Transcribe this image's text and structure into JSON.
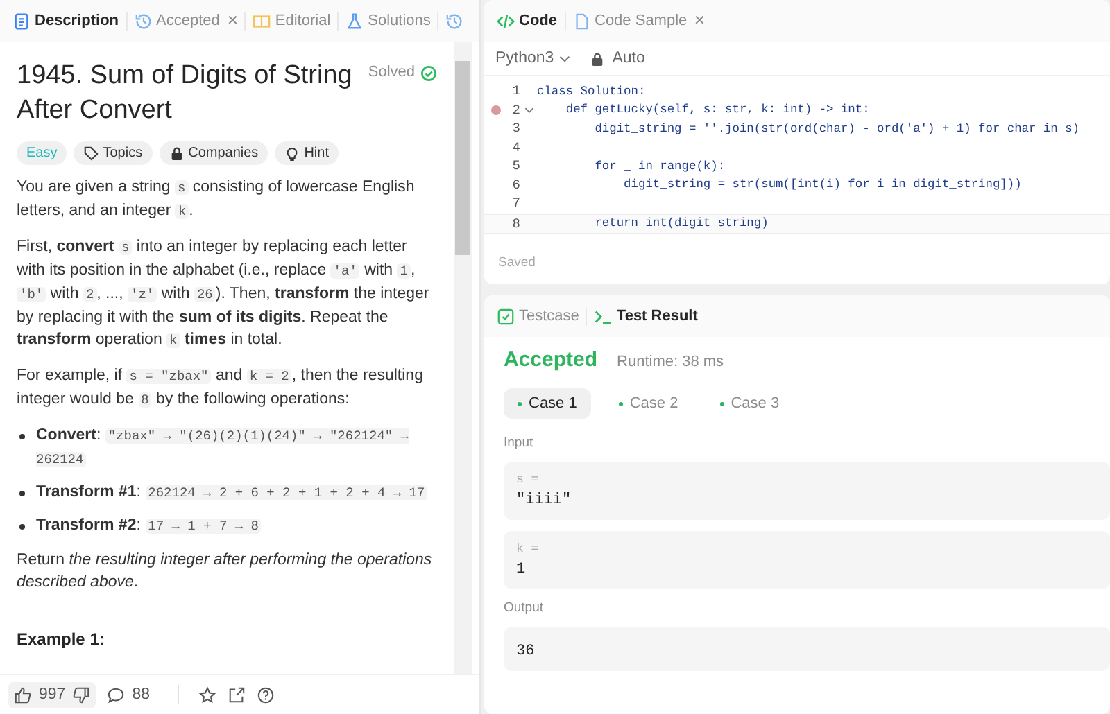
{
  "left_tabs": [
    {
      "label": "Description",
      "selected": true
    },
    {
      "label": "Accepted",
      "selected": false,
      "close": "✕"
    },
    {
      "label": "Editorial",
      "selected": false
    },
    {
      "label": "Solutions",
      "selected": false
    },
    {
      "selected": false
    }
  ],
  "problem": {
    "title": "1945. Sum of Digits of String After Convert",
    "status": "Solved",
    "difficulty": "Easy",
    "chips": [
      {
        "label": "Topics"
      },
      {
        "label": "Companies"
      },
      {
        "label": "Hint"
      }
    ],
    "paragraphs": [
      [
        {
          "kind": "text",
          "text": "You are given a string "
        },
        {
          "kind": "code",
          "text": "s"
        },
        {
          "kind": "text",
          "text": " consisting of lowercase English letters, and an integer "
        },
        {
          "kind": "code",
          "text": "k"
        },
        {
          "kind": "text",
          "text": "."
        }
      ],
      [
        {
          "kind": "text",
          "text": "First, **convert** "
        },
        {
          "kind": "code",
          "text": "s"
        },
        {
          "kind": "text",
          "text": " into an integer by replacing each letter with its position in the alphabet (i.e., replace "
        },
        {
          "kind": "code",
          "text": "'a'"
        },
        {
          "kind": "text",
          "text": " with "
        },
        {
          "kind": "code",
          "text": "1"
        },
        {
          "kind": "text",
          "text": ", "
        },
        {
          "kind": "code",
          "text": "'b'"
        },
        {
          "kind": "text",
          "text": " with "
        },
        {
          "kind": "code",
          "text": "2"
        },
        {
          "kind": "text",
          "text": ", ..., "
        },
        {
          "kind": "code",
          "text": "'z'"
        },
        {
          "kind": "text",
          "text": " with "
        },
        {
          "kind": "code",
          "text": "26"
        },
        {
          "kind": "text",
          "text": "). Then, **transform** the integer by replacing it with the **sum of its digits**. Repeat the **transform** operation "
        },
        {
          "kind": "code",
          "text": "k"
        },
        {
          "kind": "text",
          "text": " **times** in total."
        }
      ],
      [
        {
          "kind": "text",
          "text": "For example, if "
        },
        {
          "kind": "code",
          "text": "s = \"zbax\""
        },
        {
          "kind": "text",
          "text": " and "
        },
        {
          "kind": "code",
          "text": "k = 2"
        },
        {
          "kind": "text",
          "text": ", then the resulting integer would be "
        },
        {
          "kind": "code",
          "text": "8"
        },
        {
          "kind": "text",
          "text": " by the following operations:"
        }
      ]
    ],
    "steps": [
      {
        "label": "**Convert**:",
        "code": "\"zbax\" → \"(26)(2)(1)(24)\" → \"262124\" → 262124"
      },
      {
        "label": "**Transform #1**:",
        "code": "262124 → 2 + 6 + 2 + 1 + 2 + 4 → 17"
      },
      {
        "label": "**Transform #2**:",
        "code": "17 → 1 + 7 → 8"
      }
    ],
    "closing": "Return *the resulting integer after performing the operations described above*.",
    "example_heading": "Example 1:"
  },
  "footer": {
    "likes": "997",
    "comments": "88"
  },
  "code_tabs": [
    {
      "label": "Code",
      "selected": true
    },
    {
      "label": "Code Sample",
      "selected": false,
      "close": "✕"
    }
  ],
  "editor": {
    "language": "Python3",
    "mode": "Auto",
    "saved": "Saved",
    "lines": [
      {
        "number": "1",
        "text": "class Solution:",
        "breakpoint": false,
        "foldable": false
      },
      {
        "number": "2",
        "text": "    def getLucky(self, s: str, k: int) -> int:",
        "breakpoint": true,
        "foldable": true
      },
      {
        "number": "3",
        "text": "        digit_string = ''.join(str(ord(char) - ord('a') + 1) for char in s)",
        "breakpoint": false,
        "foldable": false
      },
      {
        "number": "4",
        "breakpoint": false,
        "foldable": false
      },
      {
        "number": "5",
        "text": "        for _ in range(k):",
        "breakpoint": false,
        "foldable": false
      },
      {
        "number": "6",
        "text": "            digit_string = str(sum([int(i) for i in digit_string]))",
        "breakpoint": false,
        "foldable": false
      },
      {
        "number": "7",
        "breakpoint": false,
        "foldable": false
      },
      {
        "number": "8",
        "text": "        return int(digit_string)",
        "breakpoint": false,
        "foldable": false
      }
    ]
  },
  "result_tabs": [
    {
      "label": "Testcase",
      "selected": false
    },
    {
      "label": "Test Result",
      "selected": true
    }
  ],
  "result": {
    "verdict": "Accepted",
    "runtime": "Runtime: 38 ms",
    "cases": [
      {
        "label": "Case 1",
        "selected": true
      },
      {
        "label": "Case 2",
        "selected": false
      },
      {
        "label": "Case 3",
        "selected": false
      }
    ],
    "input_label": "Input",
    "inputs": [
      {
        "name": "s =",
        "value": "\"iiii\""
      },
      {
        "name": "k =",
        "value": "1"
      }
    ],
    "output_label": "Output",
    "output": "36"
  }
}
